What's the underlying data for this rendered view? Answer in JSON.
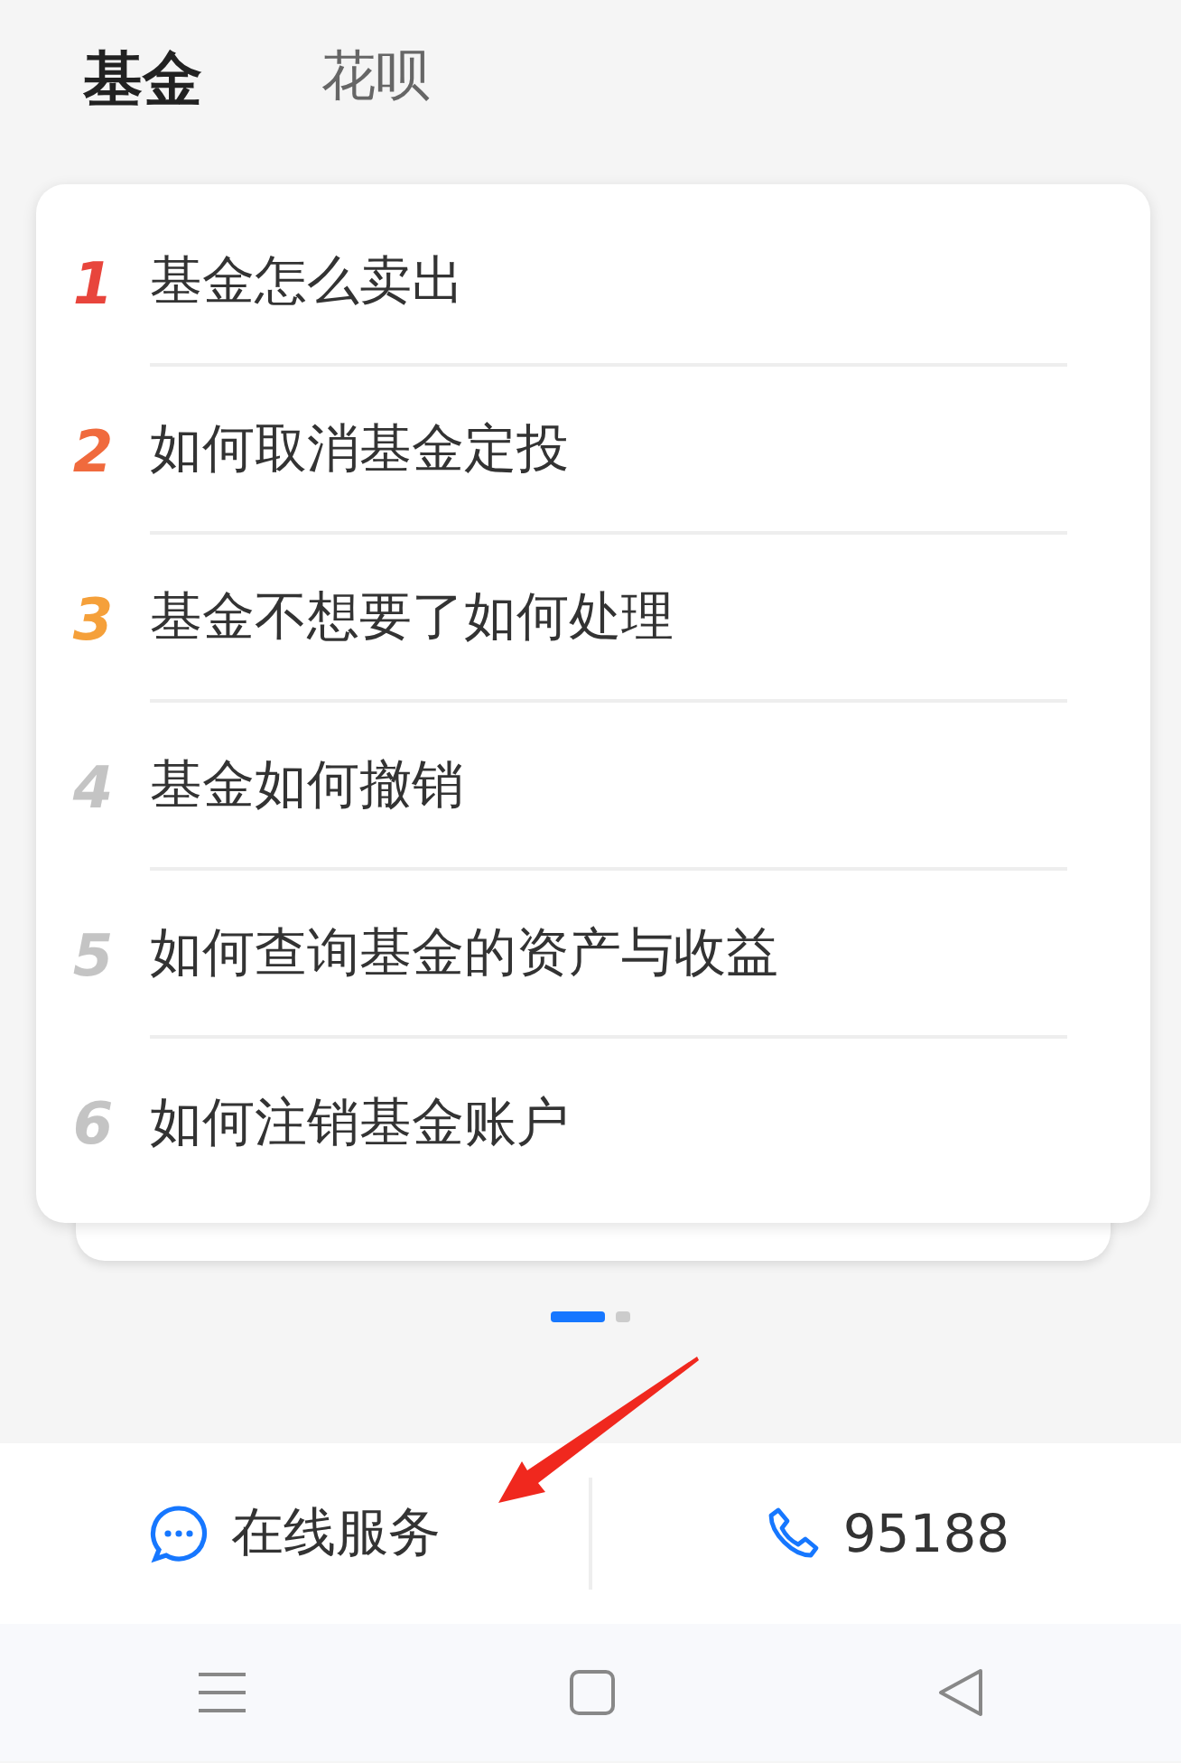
{
  "tabs": [
    {
      "label": "基金",
      "selected": true
    },
    {
      "label": "花呗",
      "selected": false
    }
  ],
  "questions": [
    {
      "rank": "1",
      "text": "基金怎么卖出",
      "color": "#e8453c"
    },
    {
      "rank": "2",
      "text": "如何取消基金定投",
      "color": "#f06a3d"
    },
    {
      "rank": "3",
      "text": "基金不想要了如何处理",
      "color": "#f5a03a"
    },
    {
      "rank": "4",
      "text": "基金如何撤销",
      "color": "#c4c4c4"
    },
    {
      "rank": "5",
      "text": "如何查询基金的资产与收益",
      "color": "#c4c4c4"
    },
    {
      "rank": "6",
      "text": "如何注销基金账户",
      "color": "#c4c4c4"
    }
  ],
  "pager": [
    {
      "selected": true
    },
    {
      "selected": false
    }
  ],
  "bottom_bar": {
    "chat": "在线服务",
    "phone": "95188"
  }
}
